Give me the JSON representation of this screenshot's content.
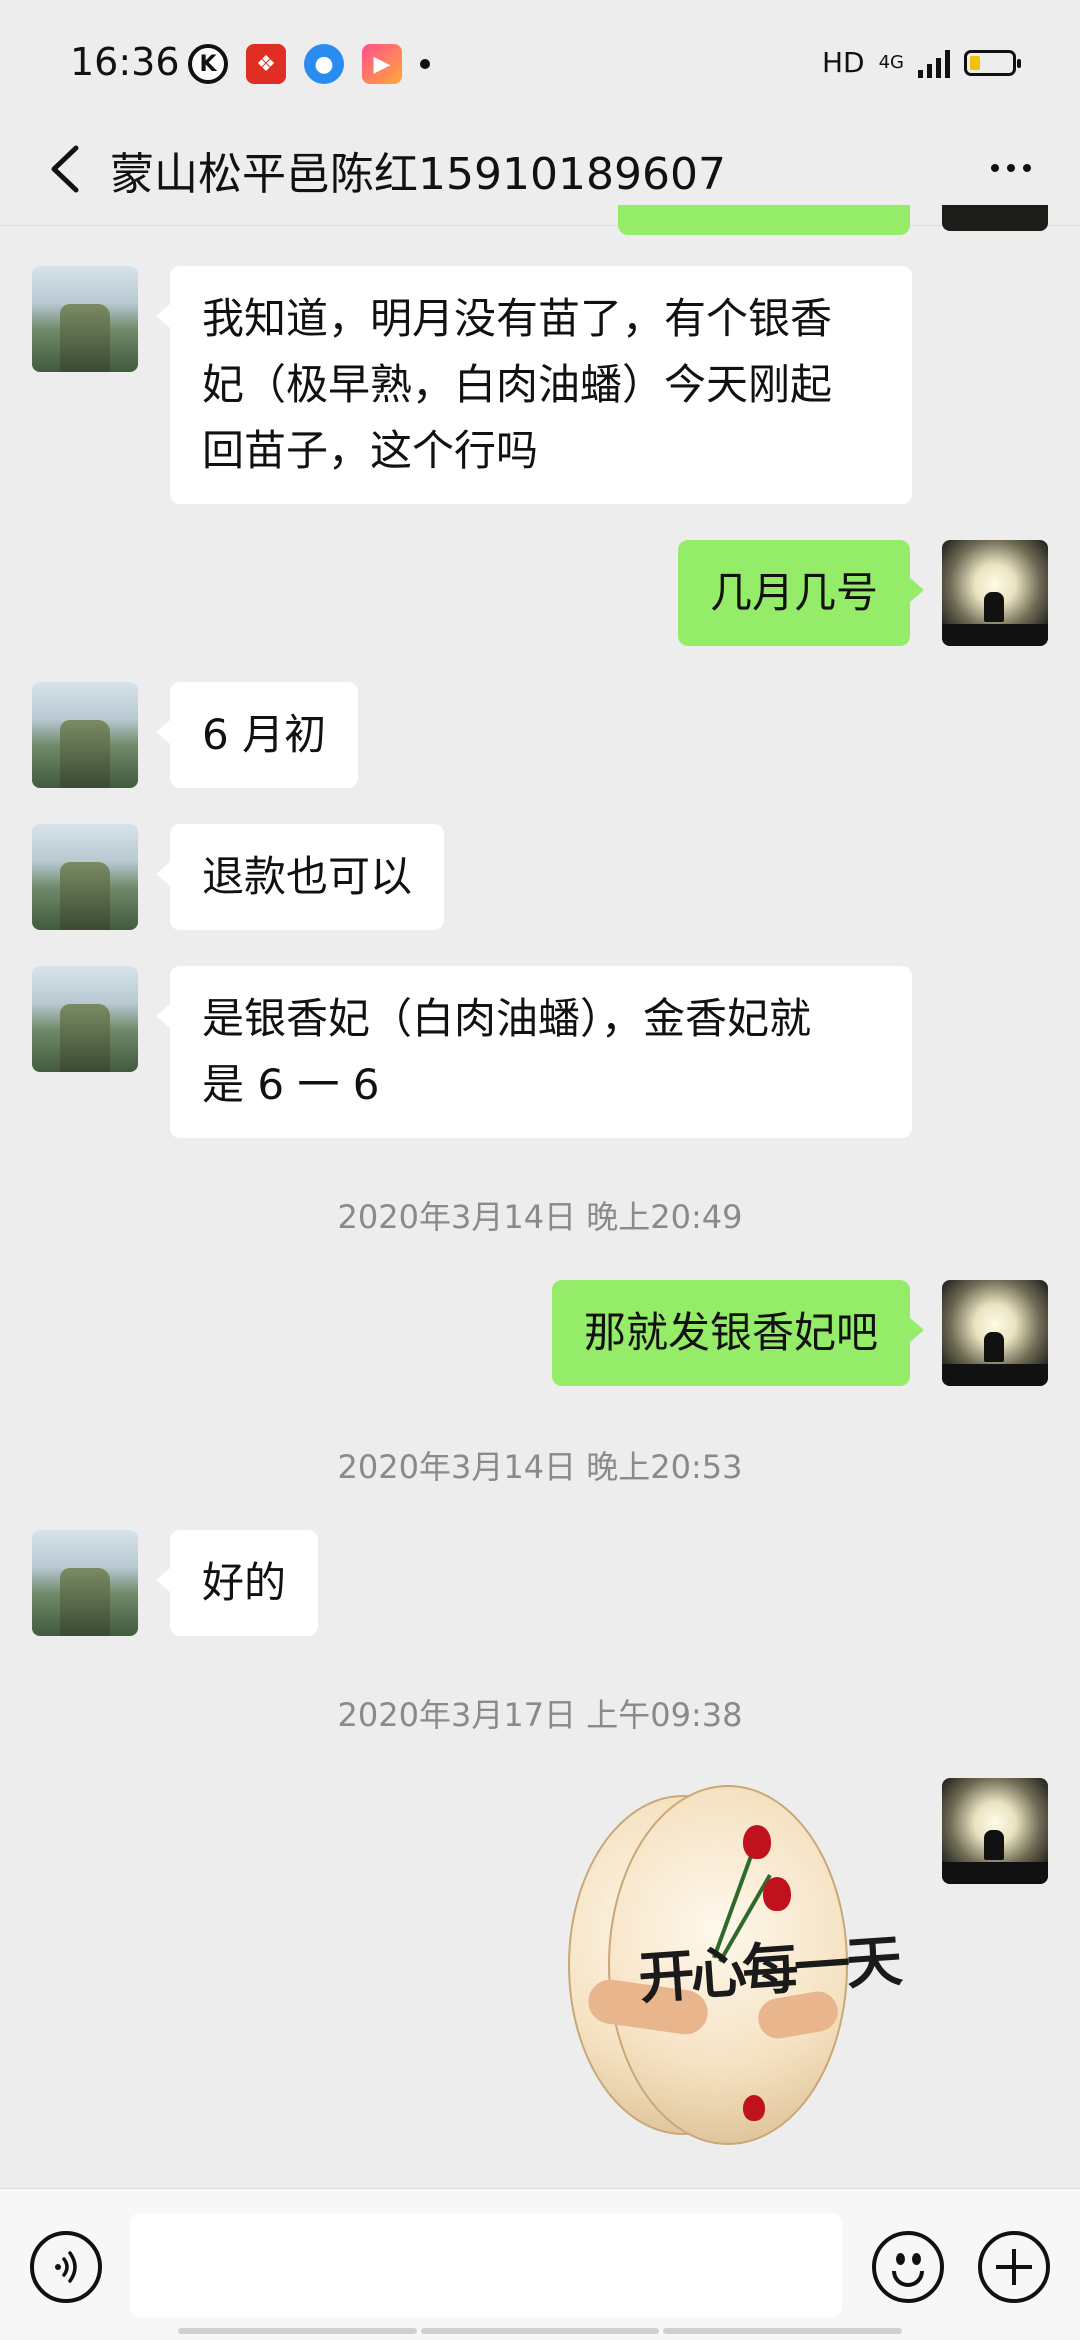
{
  "status_bar": {
    "time": "16:36",
    "hd_label": "HD",
    "network": "4G",
    "app_icons": [
      "k-icon",
      "red-app-icon",
      "blue-app-icon",
      "video-app-icon"
    ]
  },
  "header": {
    "title": "蒙山松平邑陈红15910189607",
    "back_icon": "chevron-left-icon",
    "more_icon": "more-dots-icon"
  },
  "messages": [
    {
      "from": "them",
      "text_lines": [
        "我知道，明月没有苗了，有个银香",
        "妃（极早熟，白肉油蟠）今天刚起",
        "回苗子，这个行吗"
      ]
    },
    {
      "from": "me",
      "text": "几月几号"
    },
    {
      "from": "them",
      "text": "6 月初"
    },
    {
      "from": "them",
      "text": "退款也可以"
    },
    {
      "from": "them",
      "text_lines": [
        "是银香妃（白肉油蟠），金香妃就",
        "是 6 一 6"
      ]
    },
    {
      "timestamp": "2020年3月14日 晚上20:49"
    },
    {
      "from": "me",
      "text": "那就发银香妃吧"
    },
    {
      "timestamp": "2020年3月14日 晚上20:53"
    },
    {
      "from": "them",
      "text": "好的"
    },
    {
      "timestamp": "2020年3月17日 上午09:38"
    },
    {
      "from": "me",
      "sticker_text": "开心每一天"
    }
  ],
  "input_bar": {
    "input_value": "",
    "voice_icon": "voice-icon",
    "emoji_icon": "emoji-icon",
    "plus_icon": "plus-icon"
  },
  "colors": {
    "background": "#ededed",
    "my_bubble": "#95ec69",
    "their_bubble": "#ffffff",
    "timestamp_text": "#8a8a8a"
  }
}
